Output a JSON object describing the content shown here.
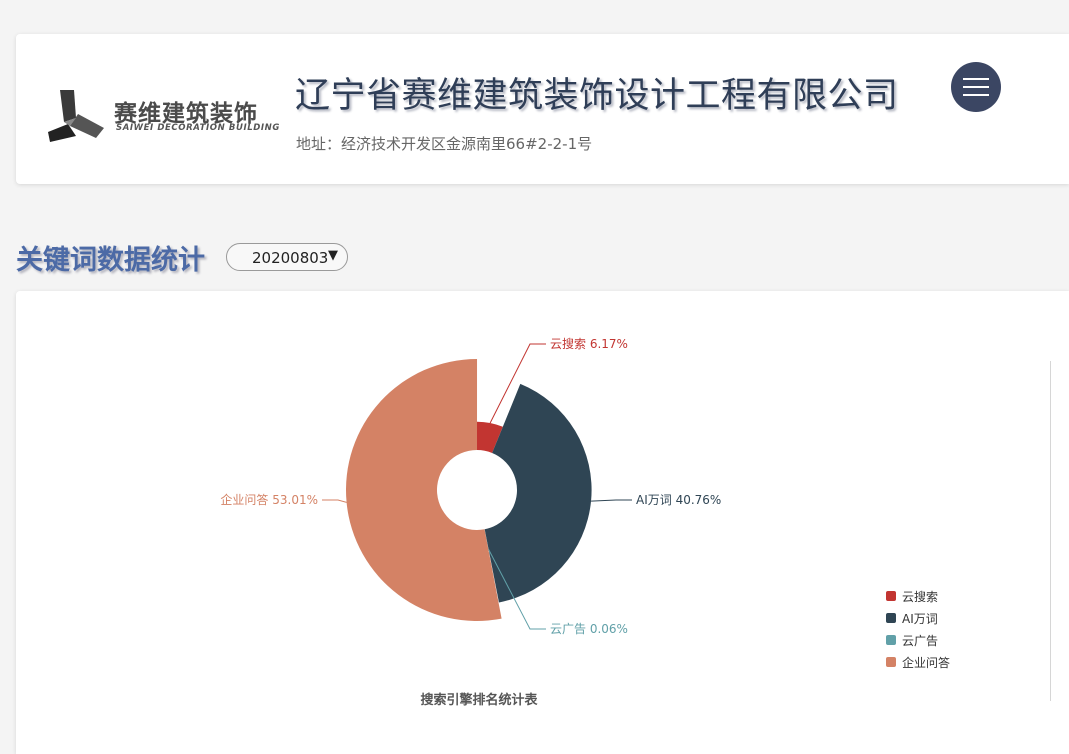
{
  "header": {
    "logo_cn": "赛维建筑装饰",
    "logo_en": "SAIWEI DECORATION BUILDING",
    "company_name": "辽宁省赛维建筑装饰设计工程有限公司",
    "address": "地址：经济技术开发区金源南里66#2-2-1号",
    "menu_icon": "hamburger-menu-icon"
  },
  "section": {
    "title": "关键词数据统计",
    "date_selected": "20200803",
    "dropdown_icon": "▼"
  },
  "chart_data": {
    "type": "pie",
    "title": "搜索引擎排名统计表",
    "legend_position": "right-bottom",
    "categories": [
      "云搜索",
      "AI万词",
      "云广告",
      "企业问答"
    ],
    "values": [
      6.17,
      40.76,
      0.06,
      53.01
    ],
    "value_labels": [
      "6.17%",
      "40.76%",
      "0.06%",
      "53.01%"
    ],
    "colors": [
      "#c23531",
      "#2f4554",
      "#61a0a8",
      "#d48265"
    ]
  }
}
